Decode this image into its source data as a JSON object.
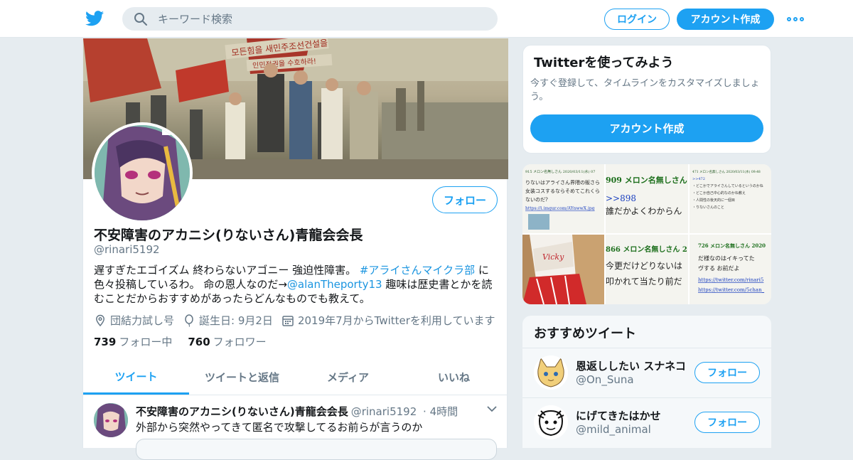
{
  "topbar": {
    "search_placeholder": "キーワード検索",
    "login_label": "ログイン",
    "signup_label": "アカウント作成"
  },
  "colors": {
    "accent": "#1da1f2",
    "muted": "#657786",
    "background": "#e6ecf0"
  },
  "profile": {
    "name": "不安障害のアカニシ(りないさん)青龍会会長",
    "handle": "@rinari5192",
    "follow_label": "フォロー",
    "bio_part1": "遅すぎたエゴイズム 終わらないアゴニー 強迫性障害。 ",
    "bio_hashtag": "#アライさんマイクラ部",
    "bio_part2": " に色々投稿しているわ。 命の恩人なのだ→",
    "bio_mention": "@alanTheporty13",
    "bio_part3": " 趣味は歴史書とかを読むことだからおすすめがあったらどんなものでも教えて。",
    "location": "団結力試し号",
    "birthday": "誕生日: 9月2日",
    "joined": "2019年7月からTwitterを利用しています",
    "following_count": "739",
    "following_label": "フォロー中",
    "followers_count": "760",
    "followers_label": "フォロワー",
    "banner_text_1": "모든힘을 새민주조선건설을",
    "banner_text_2": "인민정권을 수호하라!"
  },
  "tabs": [
    {
      "label": "ツイート",
      "active": true
    },
    {
      "label": "ツイートと返信",
      "active": false
    },
    {
      "label": "メディア",
      "active": false
    },
    {
      "label": "いいね",
      "active": false
    }
  ],
  "tweet": {
    "name": "不安障害のアカニシ(りないさん)青龍会会長",
    "handle": "@rinari5192",
    "time": "· 4時間",
    "text": "外部から突然やってきて匿名で攻撃してるお前らが言うのか"
  },
  "signup_card": {
    "title": "Twitterを使ってみよう",
    "description": "今すぐ登録して、タイムラインをカスタマイズしましょう。",
    "button_label": "アカウント作成"
  },
  "media": {
    "c1_l1": "915 メロン名無しさん 2020/03/11(水) 07",
    "c1_l2": "りないはアライさん界隈の販さら",
    "c1_l3": "女装コスするならそめてこれくら",
    "c1_l4": "ないのだ?",
    "c1_link": "https://i.imgur.com/AYnwwX.jpg",
    "c2_l1": "909 メロン名無しさん",
    "c2_l2": ">>898",
    "c2_l3": "誰だかよくわからん",
    "c3_l1": "471 メロン名無しさん 2020/03/11(水) 09:48",
    "c3_l2": ">>472",
    "c3_l3": "・どこかでアライさんしているというのかね",
    "c3_l4": "・どこか自己中心的なのかね教え",
    "c3_l5": "・人間性の後天的に一個目",
    "c3_l6": "・りないさんのこと",
    "c5_l1": "866 メロン名無しさん 2",
    "c5_l2": "今更だけどりないは",
    "c5_l3": "叩かれて当たり前だ",
    "c6_l1": "726 メロン名無しさん 2020",
    "c6_l2": "だ様なのはイキってた",
    "c6_l3": "ヴする お前だよ",
    "c6_link1": "https://twitter.com/rinari5",
    "c6_link2": "https://twitter.com/5chan_"
  },
  "recommended": {
    "title": "おすすめツイート",
    "users": [
      {
        "name": "恩返ししたい スナネコ",
        "handle": "@On_Suna",
        "follow_label": "フォロー"
      },
      {
        "name": "にげてきたはかせ",
        "handle": "@mild_animal",
        "follow_label": "フォロー"
      }
    ]
  }
}
